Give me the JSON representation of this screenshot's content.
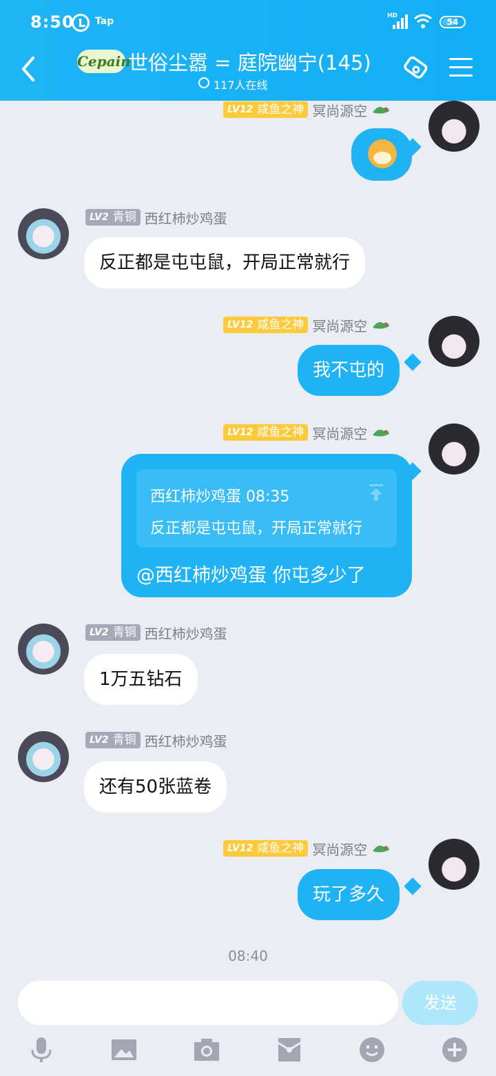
{
  "status_bar": {
    "time": "8:50",
    "tap": "Tap",
    "hd": "HD",
    "battery": "54"
  },
  "header": {
    "logo_text": "Cepain",
    "title": "世俗尘嚣 = 庭院幽宁(145)",
    "online": "117人在线"
  },
  "users": {
    "me": {
      "level": "LV12",
      "title": "咸鱼之神",
      "name": "冥尚源空"
    },
    "other": {
      "level": "LV2",
      "title": "青铜",
      "name": "西红柿炒鸡蛋"
    }
  },
  "messages": {
    "m2": "反正都是屯屯鼠，开局正常就行",
    "m3": "我不屯的",
    "m4_quote_head": "西红柿炒鸡蛋 08:35",
    "m4_quote_text": "反正都是屯屯鼠，开局正常就行",
    "m4_body": "@西红柿炒鸡蛋 你屯多少了",
    "m5": "1万五钻石",
    "m6": "还有50张蓝卷",
    "m7": "玩了多久"
  },
  "timestamp": "08:40",
  "input": {
    "placeholder": "",
    "send": "发送"
  },
  "colors": {
    "header": "#12aef5",
    "my_bubble": "#1fb3f5",
    "background": "#eaedf4",
    "gold_badge": "#ffc93c",
    "gray_badge": "#a5a9b8"
  }
}
